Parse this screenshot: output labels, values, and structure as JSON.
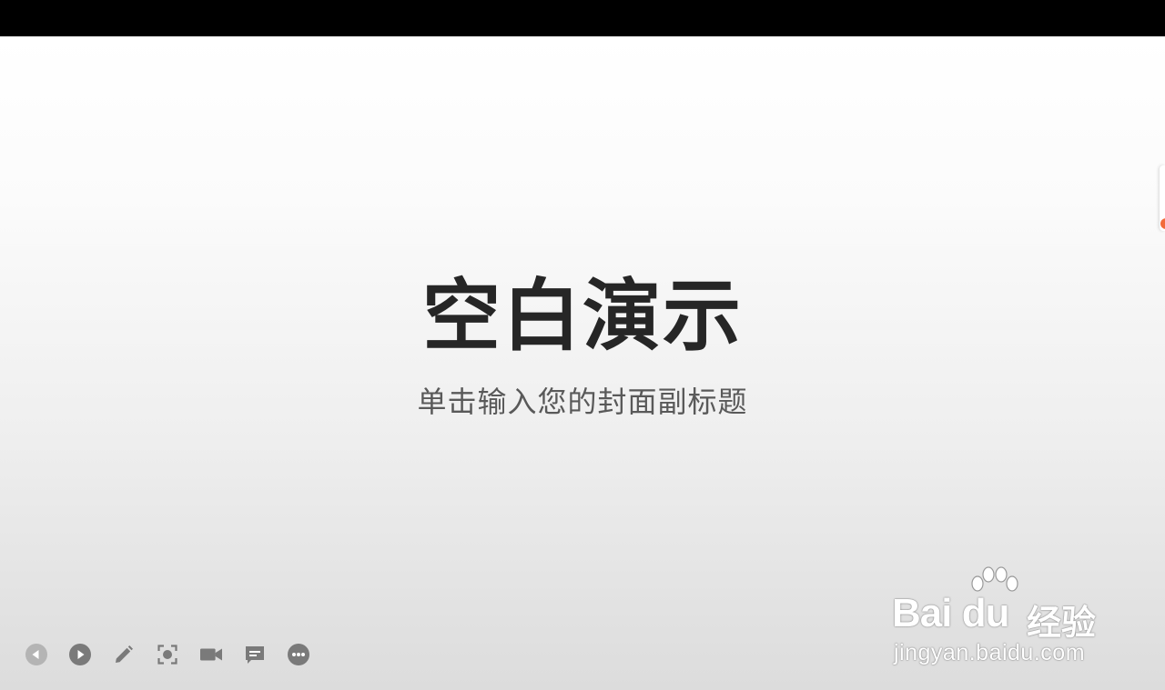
{
  "slide": {
    "title": "空白演示",
    "subtitle": "单击输入您的封面副标题"
  },
  "toolbar": {
    "items": [
      {
        "name": "previous-slide",
        "icon": "prev-arrow-icon"
      },
      {
        "name": "next-slide",
        "icon": "play-arrow-icon"
      },
      {
        "name": "pen-tool",
        "icon": "pencil-icon"
      },
      {
        "name": "spotlight",
        "icon": "focus-icon"
      },
      {
        "name": "record",
        "icon": "video-camera-icon"
      },
      {
        "name": "comments",
        "icon": "comment-icon"
      },
      {
        "name": "more",
        "icon": "more-dots-icon"
      }
    ]
  },
  "watermark": {
    "logo_text": "Bai du",
    "brand_suffix": "经验",
    "url": "jingyan.baidu.com"
  },
  "colors": {
    "title": "#262626",
    "subtitle": "#595959",
    "icon": "#7a7a7a",
    "icon_disabled": "#b4b4b4",
    "accent": "#f26b3a"
  }
}
